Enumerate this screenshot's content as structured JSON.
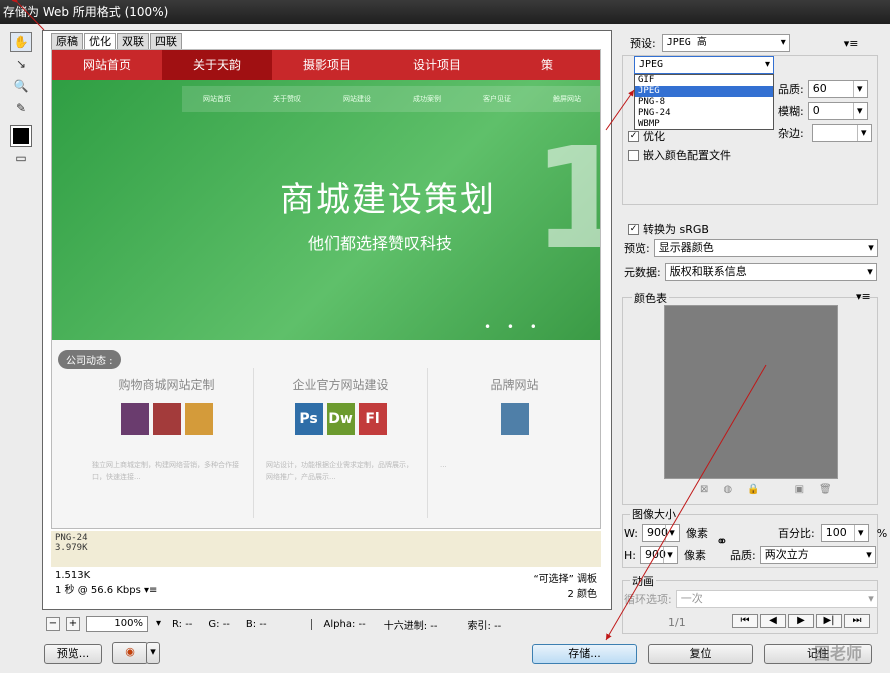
{
  "window": {
    "title": "存储为 Web 所用格式 (100%)"
  },
  "tools": [
    "hand-tool",
    "slice-select-tool",
    "zoom-tool",
    "eyedropper-tool",
    "color-swatch",
    "toggle-slices"
  ],
  "canvas": {
    "tabs": [
      "原稿",
      "优化",
      "双联",
      "四联"
    ],
    "active_tab": "优化",
    "preview": {
      "nav": [
        "网站首页",
        "关于天韵",
        "摄影项目",
        "设计项目",
        "策"
      ],
      "subnav": [
        "网站首页",
        "关于赞叹",
        "网站建设",
        "成功案例",
        "客户见证",
        "触屏网站"
      ],
      "hero_title": "商城建设策划",
      "hero_sub": "他们都选择赞叹科技",
      "hero_num": "1",
      "news_badge": "公司动态 :",
      "cards": [
        {
          "title": "购物商城网站定制",
          "text": "独立网上商城定制，构建网络营销，多种合作接口，快速连接..."
        },
        {
          "title": "企业官方网站建设",
          "text": "网站设计，功能根据企业需求定制，品牌展示，网络推广，产品展示..."
        },
        {
          "title": "品牌网站",
          "text": "..."
        }
      ]
    },
    "slice_format": "PNG-24",
    "slice_size": "3.979K",
    "file_size": "1.513K",
    "download_time": "1 秒 @ 56.6 Kbps",
    "palette_label": "“可选择” 调板",
    "color_count": "2 颜色"
  },
  "zoom": {
    "value": "100%",
    "r": "R: --",
    "g": "G: --",
    "b": "B: --",
    "alpha": "Alpha: --",
    "hex": "十六进制: --",
    "index": "索引: --"
  },
  "buttons": {
    "preview": "预览...",
    "save": "存储...",
    "reset": "复位",
    "remember": "记住"
  },
  "settings": {
    "preset_label": "预设:",
    "preset_value": "JPEG 高",
    "format_value": "JPEG",
    "format_options": [
      "GIF",
      "JPEG",
      "PNG-8",
      "PNG-24",
      "WBMP"
    ],
    "quality_label": "品质:",
    "quality_value": "60",
    "blur_label": "模糊:",
    "blur_value": "0",
    "matte_label": "杂边:",
    "optimized_label": "优化",
    "embed_profile_label": "嵌入颜色配置文件",
    "convert_srgb_label": "转换为 sRGB",
    "preview_label": "预览:",
    "preview_value": "显示器颜色",
    "metadata_label": "元数据:",
    "metadata_value": "版权和联系信息"
  },
  "color_table": {
    "title": "颜色表"
  },
  "image_size": {
    "title": "图像大小",
    "w_label": "W:",
    "w_value": "900",
    "h_label": "H:",
    "h_value": "900",
    "unit": "像素",
    "percent_label": "百分比:",
    "percent_value": "100",
    "percent_unit": "%",
    "quality_label": "品质:",
    "quality_value": "两次立方"
  },
  "animation": {
    "title": "动画",
    "loop_label": "循环选项:",
    "loop_value": "一次",
    "frame": "1/1"
  },
  "watermark": "图老师"
}
